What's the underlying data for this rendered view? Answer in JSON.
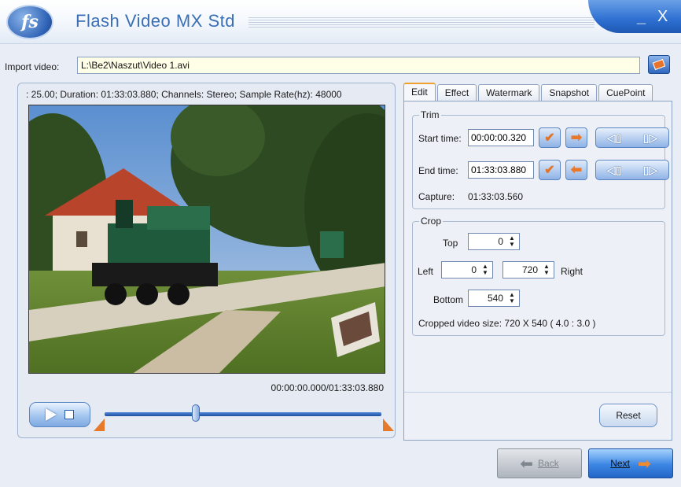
{
  "window": {
    "logo_text": "fs",
    "title": "Flash Video MX Std",
    "minimize": "_",
    "close": "X"
  },
  "import": {
    "label": "Import video:",
    "path": "L:\\Be2\\Naszut\\Video 1.avi"
  },
  "video": {
    "info": ": 25.00;  Duration: 01:33:03.880;  Channels: Stereo;  Sample Rate(hz): 48000",
    "position": "00:00:00.000/01:33:03.880",
    "slider_fraction": 0.33
  },
  "tabs": [
    "Edit",
    "Effect",
    "Watermark",
    "Snapshot",
    "CuePoint"
  ],
  "trim": {
    "title": "Trim",
    "start_label": "Start time:",
    "start_value": "00:00:00.320",
    "end_label": "End time:",
    "end_value": "01:33:03.880",
    "capture_label": "Capture:",
    "capture_value": "01:33:03.560"
  },
  "crop": {
    "title": "Crop",
    "top_label": "Top",
    "top_value": "0",
    "left_label": "Left",
    "left_value": "0",
    "right_value": "720",
    "right_label": "Right",
    "bottom_label": "Bottom",
    "bottom_value": "540",
    "size_text": "Cropped video size: 720 X 540  ( 4.0 : 3.0 )"
  },
  "buttons": {
    "reset": "Reset",
    "back": "Back",
    "next": "Next"
  },
  "colors": {
    "accent_blue": "#2d6fd1",
    "accent_orange": "#e9782b",
    "import_field_bg": "#ffffe8"
  }
}
